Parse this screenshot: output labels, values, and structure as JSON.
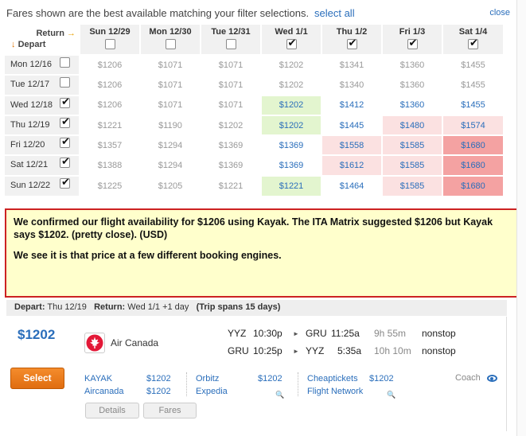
{
  "filter_bar": {
    "message": "Fares shown are the best available matching your filter selections.",
    "select_all": "select all",
    "close": "close"
  },
  "grid": {
    "return_label": "Return",
    "return_arrow": "→",
    "depart_label": "Depart",
    "depart_arrow": "↓",
    "columns": [
      {
        "label": "Sun 12/29",
        "checked": false
      },
      {
        "label": "Mon 12/30",
        "checked": false
      },
      {
        "label": "Tue 12/31",
        "checked": false
      },
      {
        "label": "Wed 1/1",
        "checked": true
      },
      {
        "label": "Thu 1/2",
        "checked": true
      },
      {
        "label": "Fri 1/3",
        "checked": true
      },
      {
        "label": "Sat 1/4",
        "checked": true
      }
    ],
    "rows": [
      {
        "label": "Mon 12/16",
        "checked": false,
        "cells": [
          "$1206",
          "$1071",
          "$1071",
          "$1202",
          "$1341",
          "$1360",
          "$1455"
        ],
        "styles": [
          "",
          "",
          "",
          "",
          "",
          "",
          ""
        ]
      },
      {
        "label": "Tue 12/17",
        "checked": false,
        "cells": [
          "$1206",
          "$1071",
          "$1071",
          "$1202",
          "$1340",
          "$1360",
          "$1455"
        ],
        "styles": [
          "",
          "",
          "",
          "",
          "",
          "",
          ""
        ]
      },
      {
        "label": "Wed 12/18",
        "checked": true,
        "cells": [
          "$1206",
          "$1071",
          "$1071",
          "$1202",
          "$1412",
          "$1360",
          "$1455"
        ],
        "styles": [
          "",
          "",
          "",
          "green",
          "v",
          "v",
          "v"
        ]
      },
      {
        "label": "Thu 12/19",
        "checked": true,
        "cells": [
          "$1221",
          "$1190",
          "$1202",
          "$1202",
          "$1445",
          "$1480",
          "$1574"
        ],
        "styles": [
          "",
          "",
          "",
          "green",
          "v",
          "pink1",
          "pink1"
        ]
      },
      {
        "label": "Fri 12/20",
        "checked": true,
        "cells": [
          "$1357",
          "$1294",
          "$1369",
          "$1369",
          "$1558",
          "$1585",
          "$1680"
        ],
        "styles": [
          "",
          "",
          "",
          "v",
          "pink1",
          "pink1",
          "pink3"
        ]
      },
      {
        "label": "Sat 12/21",
        "checked": true,
        "cells": [
          "$1388",
          "$1294",
          "$1369",
          "$1369",
          "$1612",
          "$1585",
          "$1680"
        ],
        "styles": [
          "",
          "",
          "",
          "v",
          "pink1",
          "pink1",
          "pink3"
        ]
      },
      {
        "label": "Sun 12/22",
        "checked": true,
        "cells": [
          "$1225",
          "$1205",
          "$1221",
          "$1221",
          "$1464",
          "$1585",
          "$1680"
        ],
        "styles": [
          "",
          "",
          "",
          "green",
          "v",
          "pink1",
          "pink3"
        ]
      }
    ]
  },
  "note": {
    "line1": "We confirmed our flight availability for $1206 using Kayak. The ITA Matrix suggested $1206 but Kayak says $1202. (pretty close). (USD)",
    "line2": "We see it is that price at a few different booking engines."
  },
  "summary": {
    "depart_label": "Depart:",
    "depart_value": "Thu 12/19",
    "return_label": "Return:",
    "return_value": "Wed 1/1 +1 day",
    "span": "(Trip spans 15 days)"
  },
  "result": {
    "price": "$1202",
    "airline": "Air Canada",
    "legs": [
      {
        "from": "YYZ",
        "dep": "10:30p",
        "to": "GRU",
        "arr": "11:25a",
        "duration": "9h 55m",
        "stops": "nonstop"
      },
      {
        "from": "GRU",
        "dep": "10:25p",
        "to": "YYZ",
        "arr": "5:35a",
        "duration": "10h 10m",
        "stops": "nonstop"
      }
    ],
    "select_label": "Select",
    "providers": [
      {
        "name": "KAYAK",
        "price": "$1202"
      },
      {
        "name": "Aircanada",
        "price": "$1202"
      },
      {
        "name": "Orbitz",
        "price": "$1202"
      },
      {
        "name": "Expedia",
        "price": ""
      },
      {
        "name": "Cheaptickets",
        "price": "$1202"
      },
      {
        "name": "Flight Network",
        "price": ""
      }
    ],
    "cabin": "Coach",
    "details_label": "Details",
    "fares_label": "Fares",
    "colors": {
      "accent": "#2a6ebb",
      "select": "#e8781a",
      "highlight": "#cc2222"
    }
  }
}
